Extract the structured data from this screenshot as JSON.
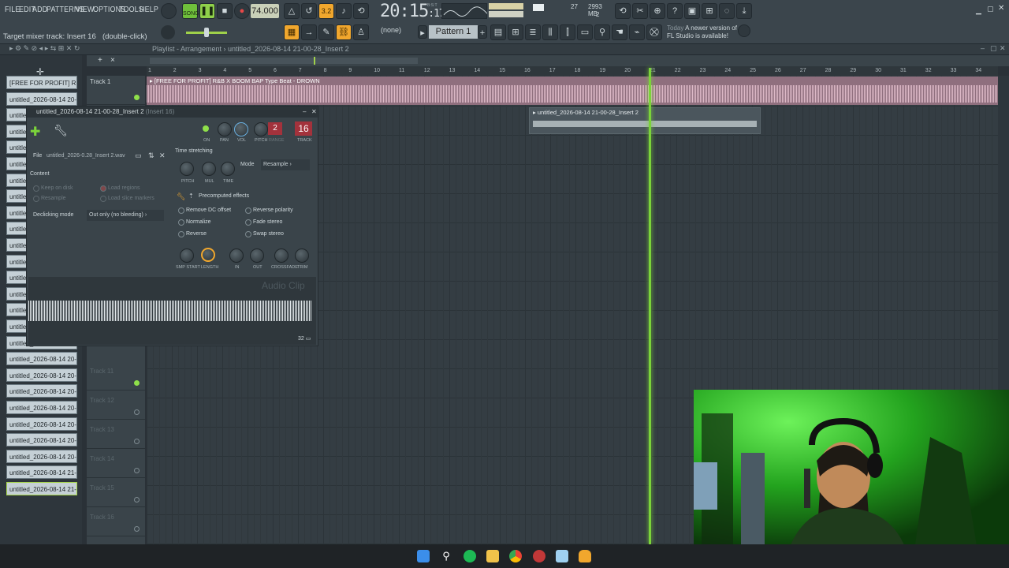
{
  "menu": [
    "FILE",
    "EDIT",
    "ADD",
    "PATTERNS",
    "VIEW",
    "OPTIONS",
    "TOOLS",
    "HELP"
  ],
  "transport": {
    "song_label": "SONG",
    "tempo": "74.000",
    "time": "20:15",
    "time_sub": "17",
    "time_sub2": "B:S:T"
  },
  "cpu": {
    "value": "27",
    "memory": "2993 MB",
    "voices": "2"
  },
  "hint": {
    "text": "Target mixer track: Insert 16",
    "action": "(double-click)"
  },
  "pattern": {
    "none": "(none)",
    "name": "Pattern 1"
  },
  "news": {
    "day": "Today",
    "line1": "A newer version of",
    "line2": "FL Studio is available!"
  },
  "playlist": {
    "title": "Playlist - Arrangement",
    "project": "untitled_2026-08-14 21-00-28_Insert 2"
  },
  "ruler": [
    "1",
    "2",
    "3",
    "4",
    "5",
    "6",
    "7",
    "8",
    "9",
    "10",
    "11",
    "12",
    "13",
    "14",
    "15",
    "16",
    "17",
    "18",
    "19",
    "20",
    "21",
    "22",
    "23",
    "24",
    "25",
    "26",
    "27",
    "28",
    "29",
    "30",
    "31",
    "32",
    "33",
    "34"
  ],
  "browser_items": [
    "[FREE FOR PROFIT] R...",
    "untitled_2026-08-14 20-",
    "untitled_2026-08-14 20-",
    "untitled_2026-08-14 20-",
    "untitled_2026-08-14 20-",
    "untitled_2026-08-14 20-",
    "untitled_2026-08-14 20-",
    "untitled_2026-08-14 20-",
    "untitled_2026-08-14 20-",
    "untitled_2026-08-14 20-",
    "untitled_2026-08-14 20-",
    "untitled_2026-08-14 20-",
    "untitled_2026-08-14 20-",
    "untitled_2026-08-14 20-",
    "untitled_2026-08-14 20-",
    "untitled_2026-08-14 20-",
    "untitled_2026-08-14 20-",
    "untitled_2026-08-14 20-",
    "untitled_2026-08-14 20-",
    "untitled_2026-08-14 20-",
    "untitled_2026-08-14 20-",
    "untitled_2026-08-14 20-",
    "untitled_2026-08-14 20-",
    "untitled_2026-08-14 20-",
    "untitled_2026-08-14 21-",
    "untitled_2026-08-14 21-"
  ],
  "tracks": [
    {
      "name": "Track 1"
    },
    {
      "name": "Track 11"
    },
    {
      "name": "Track 12"
    },
    {
      "name": "Track 13"
    },
    {
      "name": "Track 14"
    },
    {
      "name": "Track 15"
    },
    {
      "name": "Track 16"
    }
  ],
  "clips": {
    "main": "[FREE FOR PROFIT] R&B X BOOM BAP Type Beat - DROWN",
    "second": "untitled_2026-08-14 21-00-28_Insert 2"
  },
  "channel": {
    "title": "untitled_2026-08-14 21-00-28_Insert 2",
    "insert": "(Insert 16)",
    "knob_labels": [
      "ON",
      "PAN",
      "VOL",
      "PITCH",
      "RANGE",
      "TRACK"
    ],
    "range": "2",
    "track": "16",
    "file_label": "File",
    "file_name": "untitled_2026-0.28_Insert 2.wav",
    "content": "Content",
    "keep_on_disk": "Keep on disk",
    "load_regions": "Load regions",
    "resample": "Resample",
    "load_slice": "Load slice markers",
    "declick_label": "Declicking mode",
    "declick_value": "Out only (no bleeding)",
    "time_stretching": "Time stretching",
    "mode_label": "Mode",
    "mode_value": "Resample",
    "ts_knobs": [
      "PITCH",
      "MUL",
      "TIME"
    ],
    "precomputed": "Precomputed effects",
    "fx": [
      "Remove DC offset",
      "Reverse polarity",
      "Normalize",
      "Fade stereo",
      "Reverse",
      "Swap stereo"
    ],
    "fx_knobs": [
      "SMP START",
      "LENGTH",
      "IN",
      "OUT",
      "CROSSFADE",
      "TRIM"
    ],
    "audio_clip": "Audio Clip",
    "zoom": "32"
  }
}
